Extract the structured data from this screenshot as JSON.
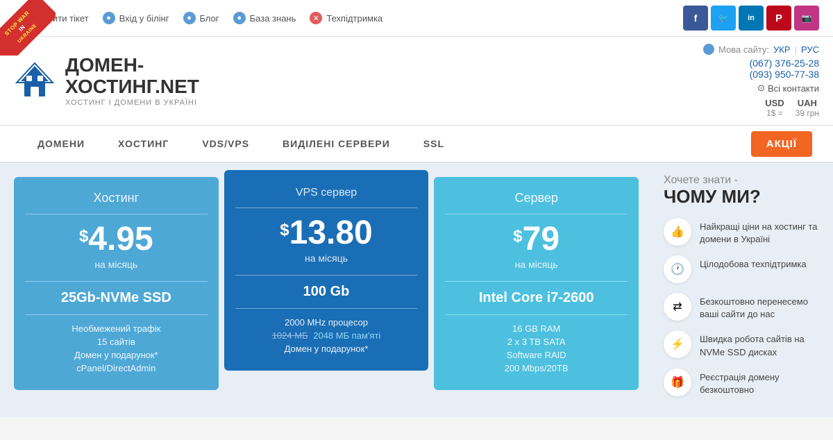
{
  "war_banner": {
    "line1": "STOP WAR",
    "line2": "IN",
    "line3": "UKRAINE"
  },
  "topnav": {
    "items": [
      {
        "label": "Відкрити тікет",
        "icon": "ticket-icon"
      },
      {
        "label": "Вхід у білінг",
        "icon": "billing-icon"
      },
      {
        "label": "Блог",
        "icon": "blog-icon"
      },
      {
        "label": "База знань",
        "icon": "knowledge-icon"
      },
      {
        "label": "Техпідтримка",
        "icon": "support-icon"
      }
    ]
  },
  "social": {
    "items": [
      {
        "label": "f",
        "name": "facebook"
      },
      {
        "label": "t",
        "name": "twitter"
      },
      {
        "label": "in",
        "name": "linkedin"
      },
      {
        "label": "P",
        "name": "pinterest"
      },
      {
        "label": "ig",
        "name": "instagram"
      }
    ]
  },
  "logo": {
    "line1": "ДОМЕН-",
    "line2_prefix": "ХОСТИНГ",
    "line2_suffix": ".NET",
    "tagline": "ХОСТИНГ І ДОМЕНИ В УКРАЇНІ"
  },
  "header": {
    "lang_label": "Мова сайту:",
    "lang_ukr": "УКР",
    "lang_rus": "РУС",
    "phone1": "(067) 376-25-28",
    "phone2": "(093) 950-77-38",
    "contacts_label": "Всі контакти"
  },
  "currency": {
    "usd_label": "USD",
    "usd_rate": "1$ =",
    "uah_label": "UAH",
    "uah_rate": "39 грн"
  },
  "nav": {
    "items": [
      {
        "label": "ДОМЕНИ"
      },
      {
        "label": "ХОСТИНГ"
      },
      {
        "label": "VDS/VPS"
      },
      {
        "label": "ВИДІЛЕНІ СЕРВЕРИ"
      },
      {
        "label": "SSL"
      }
    ],
    "cta": "АКЦІЇ"
  },
  "pricing": {
    "cards": [
      {
        "id": "hosting",
        "title": "Хостинг",
        "price": "4.95",
        "currency": "$",
        "per": "на місяць",
        "feature_main": "25Gb-NVMe SSD",
        "features": [
          {
            "text": "Необмежений трафік",
            "style": "normal"
          },
          {
            "text": "15 сайтів",
            "style": "normal"
          },
          {
            "text": "Домен у подарунок*",
            "style": "normal"
          },
          {
            "text": "cPanel/DirectAdmin",
            "style": "normal"
          }
        ]
      },
      {
        "id": "vps",
        "title": "VPS сервер",
        "price": "13.80",
        "currency": "$",
        "per": "на місяць",
        "feature_main": "100 Gb",
        "features": [
          {
            "text": "2000 MHz процесор",
            "style": "normal"
          },
          {
            "text": "1024 МБ",
            "style": "strikethrough"
          },
          {
            "text": "2048 МБ пам'яті",
            "style": "highlight"
          },
          {
            "text": "Домен у подарунок*",
            "style": "normal"
          }
        ]
      },
      {
        "id": "server",
        "title": "Сервер",
        "price": "79",
        "currency": "$",
        "per": "на місяць",
        "feature_main": "Intel Core i7-2600",
        "features": [
          {
            "text": "16 GB RAM",
            "style": "normal"
          },
          {
            "text": "2 x 3 TB SATA",
            "style": "normal"
          },
          {
            "text": "Software RAID",
            "style": "normal"
          },
          {
            "text": "200 Mbps/20TB",
            "style": "normal"
          }
        ]
      }
    ]
  },
  "sidebar": {
    "subtitle": "Хочете знати -",
    "title": "ЧОМУ МИ?",
    "items": [
      {
        "icon": "thumbs-up-icon",
        "text": "Найкращі ціни на хостинг та домени в Україні"
      },
      {
        "icon": "clock-icon",
        "text": "Цілодобова техпідтримка"
      },
      {
        "icon": "transfer-icon",
        "text": "Безкоштовно перенесемо ваші сайти до нас"
      },
      {
        "icon": "speed-icon",
        "text": "Швидка робота сайтів на NVMe SSD дисках"
      },
      {
        "icon": "gift-icon",
        "text": "Реєстрація домену безкоштовно"
      }
    ]
  }
}
